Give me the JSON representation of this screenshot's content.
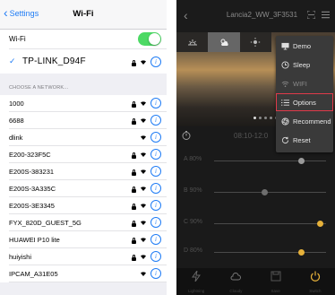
{
  "wifi_settings": {
    "back_label": "Settings",
    "title": "Wi-Fi",
    "wifi_label": "Wi-Fi",
    "wifi_enabled": true,
    "connected_network": "TP-LINK_D94F",
    "section_header": "CHOOSE A NETWORK...",
    "networks": [
      {
        "name": "1000",
        "locked": true
      },
      {
        "name": "6688",
        "locked": true
      },
      {
        "name": "dlink",
        "locked": false
      },
      {
        "name": "E200-323F5C",
        "locked": true
      },
      {
        "name": "E200S-383231",
        "locked": true
      },
      {
        "name": "E200S-3A335C",
        "locked": true
      },
      {
        "name": "E200S-3E3345",
        "locked": true
      },
      {
        "name": "FYX_820D_GUEST_5G",
        "locked": true
      },
      {
        "name": "HUAWEI P10 lite",
        "locked": true
      },
      {
        "name": "huiyishi",
        "locked": true
      },
      {
        "name": "IPCAM_A31E05",
        "locked": false
      }
    ]
  },
  "app": {
    "device_title": "Lancia2_WW_3F3531",
    "time_text": "08:10-12:0",
    "channels": [
      {
        "label": "A",
        "value": "80%",
        "level": 0.78,
        "color": "#9a9a9a"
      },
      {
        "label": "B",
        "value": "90%",
        "level": 0.45,
        "color": "#6e6e6e"
      },
      {
        "label": "C",
        "value": "90%",
        "level": 0.95,
        "color": "#e6b13a"
      },
      {
        "label": "D",
        "value": "80%",
        "level": 0.78,
        "color": "#e6b13a"
      }
    ],
    "menu": [
      {
        "label": "Demo",
        "icon": "monitor-icon",
        "disabled": false,
        "highlighted": false
      },
      {
        "label": "Sleep",
        "icon": "clock-icon",
        "disabled": false,
        "highlighted": false
      },
      {
        "label": "WIFI",
        "icon": "wifi-icon",
        "disabled": true,
        "highlighted": false
      },
      {
        "label": "Options",
        "icon": "list-icon",
        "disabled": false,
        "highlighted": true
      },
      {
        "label": "Recommend",
        "icon": "aperture-icon",
        "disabled": false,
        "highlighted": false
      },
      {
        "label": "Reset",
        "icon": "refresh-icon",
        "disabled": false,
        "highlighted": false
      }
    ],
    "bottom_tabs": [
      {
        "label": "Lightning",
        "icon": "lightning-icon"
      },
      {
        "label": "Cloudy",
        "icon": "cloud-icon"
      },
      {
        "label": "Save",
        "icon": "save-icon"
      },
      {
        "label": "Switch",
        "icon": "power-icon"
      }
    ],
    "colors": {
      "accent": "#e6b13a",
      "highlight_outline": "#e03a4a",
      "ios_blue": "#1f7cf5",
      "toggle_green": "#4cd964"
    }
  }
}
